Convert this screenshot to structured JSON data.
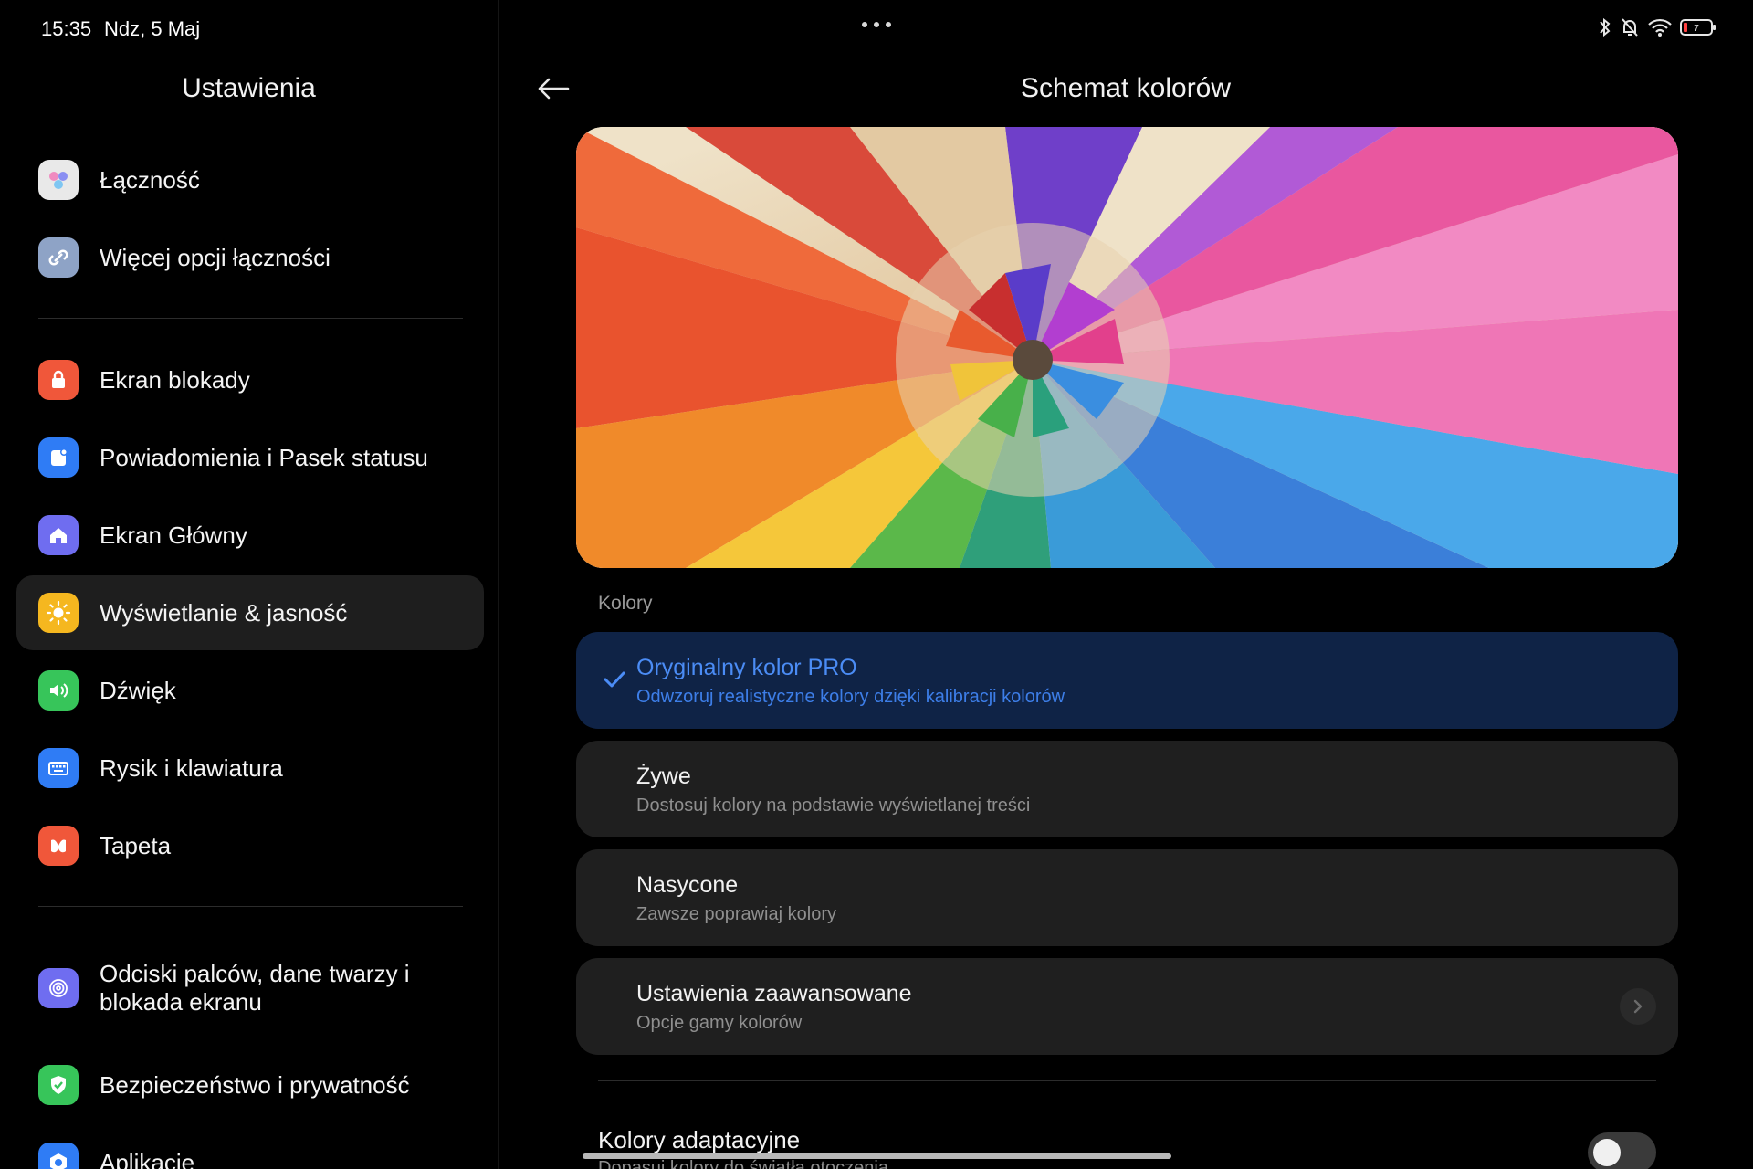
{
  "status_bar": {
    "time": "15:35",
    "date": "Ndz, 5 Maj",
    "battery_level": "7",
    "icons": [
      "bluetooth-icon",
      "bell-off-icon",
      "wifi-icon",
      "battery-icon"
    ]
  },
  "sidebar": {
    "title": "Ustawienia",
    "groups": [
      [
        {
          "label": "Łączność",
          "icon": "connectivity-icon",
          "color": "#e9e9e9"
        },
        {
          "label": "Więcej opcji łączności",
          "icon": "link-icon",
          "color": "#8ea3c6"
        }
      ],
      [
        {
          "label": "Ekran blokady",
          "icon": "lock-icon",
          "color": "#f0573a"
        },
        {
          "label": "Powiadomienia i Pasek statusu",
          "icon": "notification-icon",
          "color": "#2f7cf5"
        },
        {
          "label": "Ekran Główny",
          "icon": "home-icon",
          "color": "#6f6df0"
        },
        {
          "label": "Wyświetlanie & jasność",
          "icon": "sun-icon",
          "color": "#f5b71f",
          "active": true
        },
        {
          "label": "Dźwięk",
          "icon": "speaker-icon",
          "color": "#37c55a"
        },
        {
          "label": "Rysik i klawiatura",
          "icon": "keyboard-icon",
          "color": "#2f7cf5"
        },
        {
          "label": "Tapeta",
          "icon": "wallpaper-icon",
          "color": "#f0573a"
        }
      ],
      [
        {
          "label": "Odciski palców, dane twarzy i blokada ekranu",
          "icon": "fingerprint-icon",
          "color": "#6f6df0"
        },
        {
          "label": "Bezpieczeństwo i prywatność",
          "icon": "shield-check-icon",
          "color": "#37c55a"
        },
        {
          "label": "Aplikacje",
          "icon": "apps-icon",
          "color": "#2f7cf5"
        }
      ]
    ]
  },
  "main": {
    "title": "Schemat kolorów",
    "section_label": "Kolory",
    "options": [
      {
        "title": "Oryginalny kolor PRO",
        "subtitle": "Odwzoruj realistyczne kolory dzięki kalibracji kolorów",
        "selected": true
      },
      {
        "title": "Żywe",
        "subtitle": "Dostosuj kolory na podstawie wyświetlanej treści",
        "selected": false
      },
      {
        "title": "Nasycone",
        "subtitle": "Zawsze poprawiaj kolory",
        "selected": false
      },
      {
        "title": "Ustawienia zaawansowane",
        "subtitle": "Opcje gamy kolorów",
        "selected": false,
        "has_chevron": true
      }
    ],
    "adaptive": {
      "title": "Kolory adaptacyjne",
      "subtitle": "Dopasuj kolory do światła otoczenia",
      "enabled": false
    }
  },
  "colors": {
    "accent": "#4b8cf5",
    "selected_card": "#0f2346",
    "card": "#1f1f1f"
  }
}
